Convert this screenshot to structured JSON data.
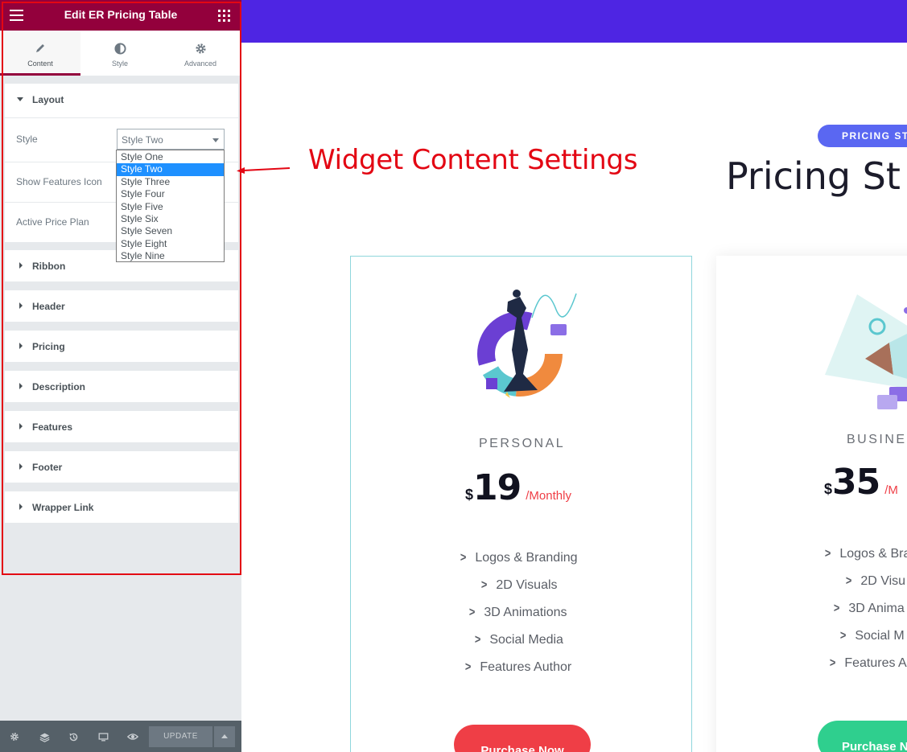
{
  "panel": {
    "title": "Edit ER Pricing Table",
    "tabs": [
      {
        "label": "Content",
        "icon": "pencil-icon",
        "active": true
      },
      {
        "label": "Style",
        "icon": "half-circle-icon",
        "active": false
      },
      {
        "label": "Advanced",
        "icon": "gear-icon",
        "active": false
      }
    ],
    "layout": {
      "title": "Layout",
      "style_label": "Style",
      "style_value": "Style Two",
      "show_features_icon_label": "Show Features Icon",
      "active_price_plan_label": "Active Price Plan"
    },
    "dropdown_options": [
      "Style One",
      "Style Two",
      "Style Three",
      "Style Four",
      "Style Five",
      "Style Six",
      "Style Seven",
      "Style Eight",
      "Style Nine"
    ],
    "sections": [
      "Ribbon",
      "Header",
      "Pricing",
      "Description",
      "Features",
      "Footer",
      "Wrapper Link"
    ],
    "footer": {
      "update_label": "UPDATE",
      "icons": [
        "gear-icon",
        "layers-icon",
        "history-icon",
        "responsive-icon",
        "eye-icon"
      ]
    }
  },
  "annotation": {
    "text": "Widget Content Settings",
    "color": "#e30613"
  },
  "preview": {
    "pill": "PRICING ST",
    "heading": "Pricing St",
    "cards": [
      {
        "name": "PERSONAL",
        "currency": "$",
        "amount": "19",
        "period": "/Monthly",
        "features": [
          "Logos & Branding",
          "2D Visuals",
          "3D Animations",
          "Social Media",
          "Features Author"
        ],
        "button": "Purchase Now",
        "button_color": "#ef3e46"
      },
      {
        "name": "BUSINES",
        "currency": "$",
        "amount": "35",
        "period": "/M",
        "features": [
          "Logos & Bra",
          "2D Visu",
          "3D Anima",
          "Social M",
          "Features A"
        ],
        "button": "Purchase N",
        "button_color": "#2fcf8e"
      }
    ]
  },
  "colors": {
    "panel_header": "#93003c",
    "top_band": "#4e25e3",
    "pill": "#5a67f2",
    "card_border": "#8fd6dc"
  }
}
